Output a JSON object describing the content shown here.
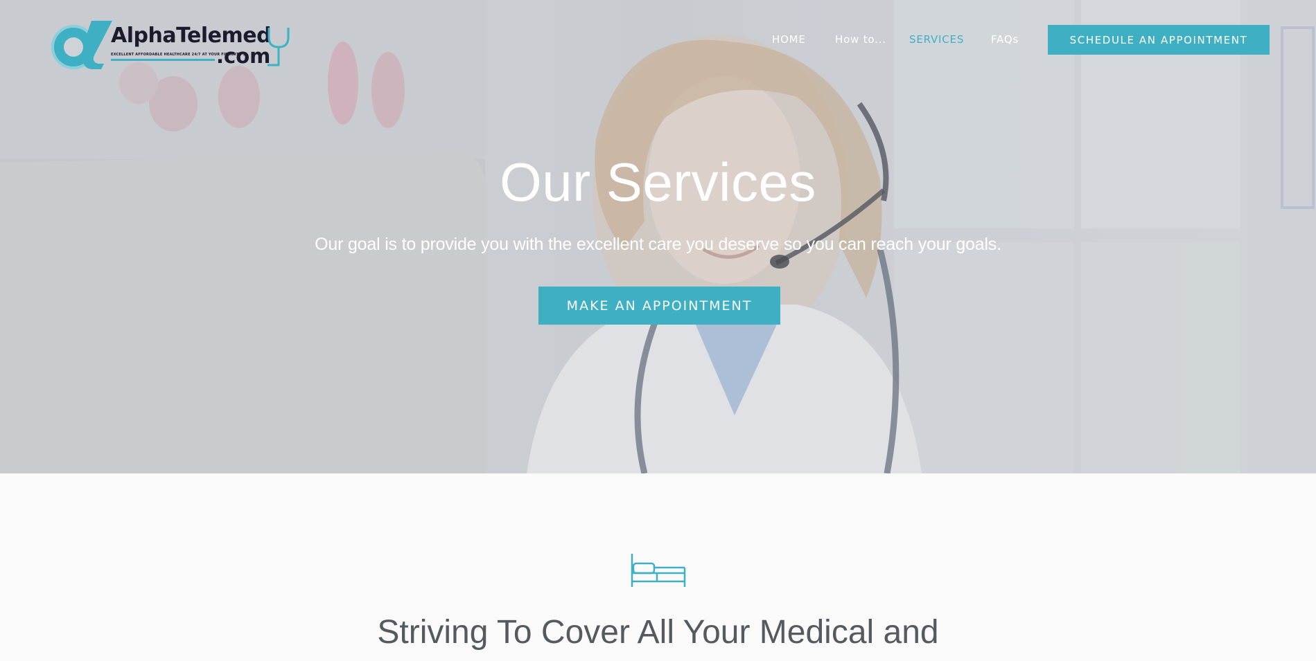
{
  "brand": {
    "name": "AlphaTelemed",
    "suffix": ".com",
    "tagline": "EXCELLENT AFFORDABLE HEALTHCARE 24/7 AT YOUR FINGERTIPS",
    "accent_color": "#3fb0c3",
    "dark_color": "#1b1b2e"
  },
  "nav": {
    "items": [
      {
        "label": "HOME",
        "active": false
      },
      {
        "label": "How to...",
        "active": false
      },
      {
        "label": "SERVICES",
        "active": true
      },
      {
        "label": "FAQs",
        "active": false
      }
    ],
    "cta_label": "SCHEDULE AN APPOINTMENT"
  },
  "hero": {
    "title": "Our Services",
    "subtitle": "Our goal is to provide you with the excellent care you deserve so you can reach your goals.",
    "cta_label": "MAKE AN APPOINTMENT"
  },
  "section": {
    "icon": "bed-icon",
    "title": "Striving To Cover All Your Medical and"
  }
}
